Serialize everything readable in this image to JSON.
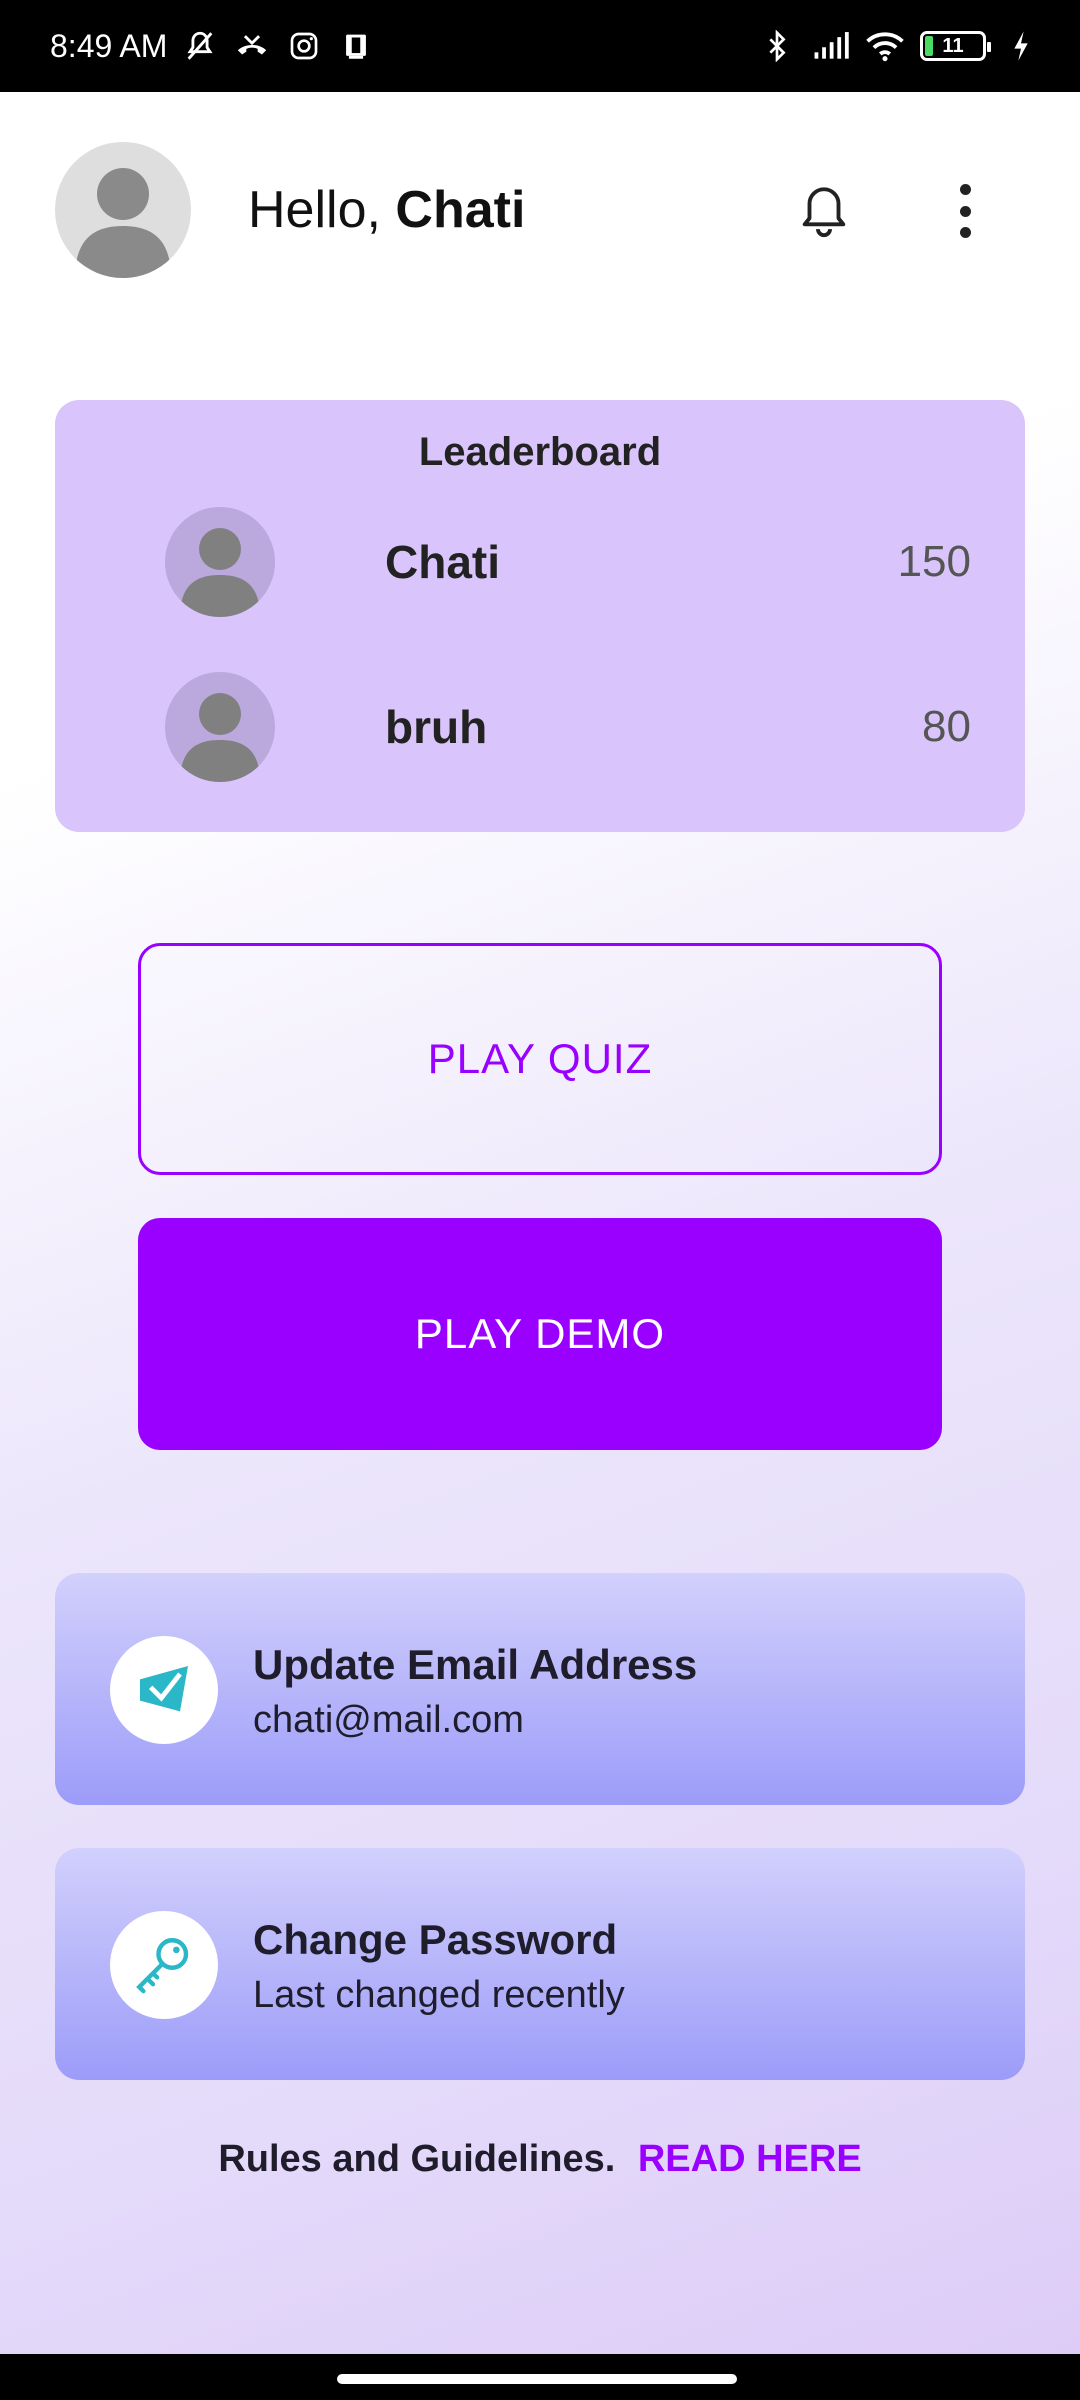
{
  "status_bar": {
    "time": "8:49 AM",
    "battery": "11",
    "icons": [
      "mute-icon",
      "missed-call-icon",
      "instagram-icon",
      "screen-icon",
      "bluetooth-icon",
      "signal-icon",
      "wifi-icon",
      "battery-icon",
      "charging-icon"
    ]
  },
  "header": {
    "greeting": "Hello,",
    "user_name": "Chati"
  },
  "leaderboard": {
    "title": "Leaderboard",
    "entries": [
      {
        "name": "Chati",
        "score": "150"
      },
      {
        "name": "bruh",
        "score": "80"
      }
    ]
  },
  "actions": {
    "play_quiz": "PLAY QUIZ",
    "play_demo": "PLAY DEMO"
  },
  "settings": {
    "email": {
      "title": "Update Email Address",
      "subtitle": "chati@mail.com"
    },
    "password": {
      "title": "Change Password",
      "subtitle": "Last changed recently"
    }
  },
  "footer": {
    "rules_text": "Rules and Guidelines.",
    "read_link": "READ HERE"
  },
  "colors": {
    "accent": "#9900ff",
    "leaderboard_bg": "#d9c4fb",
    "card_gradient_top": "#d2d0fc",
    "card_gradient_bottom": "#9c9cf9",
    "icon_teal": "#2ab7c7"
  }
}
